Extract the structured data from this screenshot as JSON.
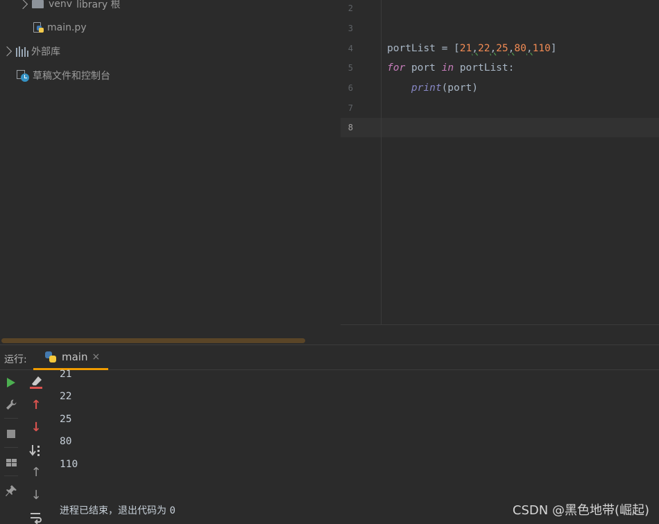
{
  "tree": {
    "venv_label": "venv",
    "venv_suffix": "library 根",
    "main_file": "main.py",
    "external_libs": "外部库",
    "scratches": "草稿文件和控制台"
  },
  "editor": {
    "line_numbers": [
      "2",
      "3",
      "4",
      "5",
      "6",
      "7",
      "8"
    ],
    "current_line": "8",
    "code": {
      "l4_var": "portList",
      "l4_eq": " = [",
      "l4_nums": [
        "21",
        "22",
        "25",
        "80",
        "110"
      ],
      "l4_sep": ",",
      "l4_close": "]",
      "l5_for": "for",
      "l5_var": " port ",
      "l5_in": "in",
      "l5_rest": " portList:",
      "l6_indent": "    ",
      "l6_fn": "print",
      "l6_rest": "(port)"
    }
  },
  "run": {
    "title": "运行:",
    "tab_label": "main",
    "close_glyph": "×",
    "output": [
      "21",
      "22",
      "25",
      "80",
      "110"
    ],
    "exit_text": "进程已结束，退出代码为 ",
    "exit_code": "0"
  },
  "icons": {
    "rerun": "play-icon",
    "settings": "wrench-icon",
    "stop": "stop-icon",
    "layout": "layout-icon",
    "pin": "pin-icon",
    "clear": "clear-eraser-icon",
    "up_red": "arrow-up-icon",
    "down_red": "arrow-down-icon",
    "sort": "sort-icon",
    "scroll_up": "scroll-up-icon",
    "scroll_down": "scroll-down-icon",
    "wrap": "soft-wrap-icon"
  },
  "watermark": "CSDN @黑色地带(崛起)",
  "colors": {
    "accent": "#ef9b00",
    "play": "#4caf50",
    "red_arrows": "#d9534f"
  }
}
